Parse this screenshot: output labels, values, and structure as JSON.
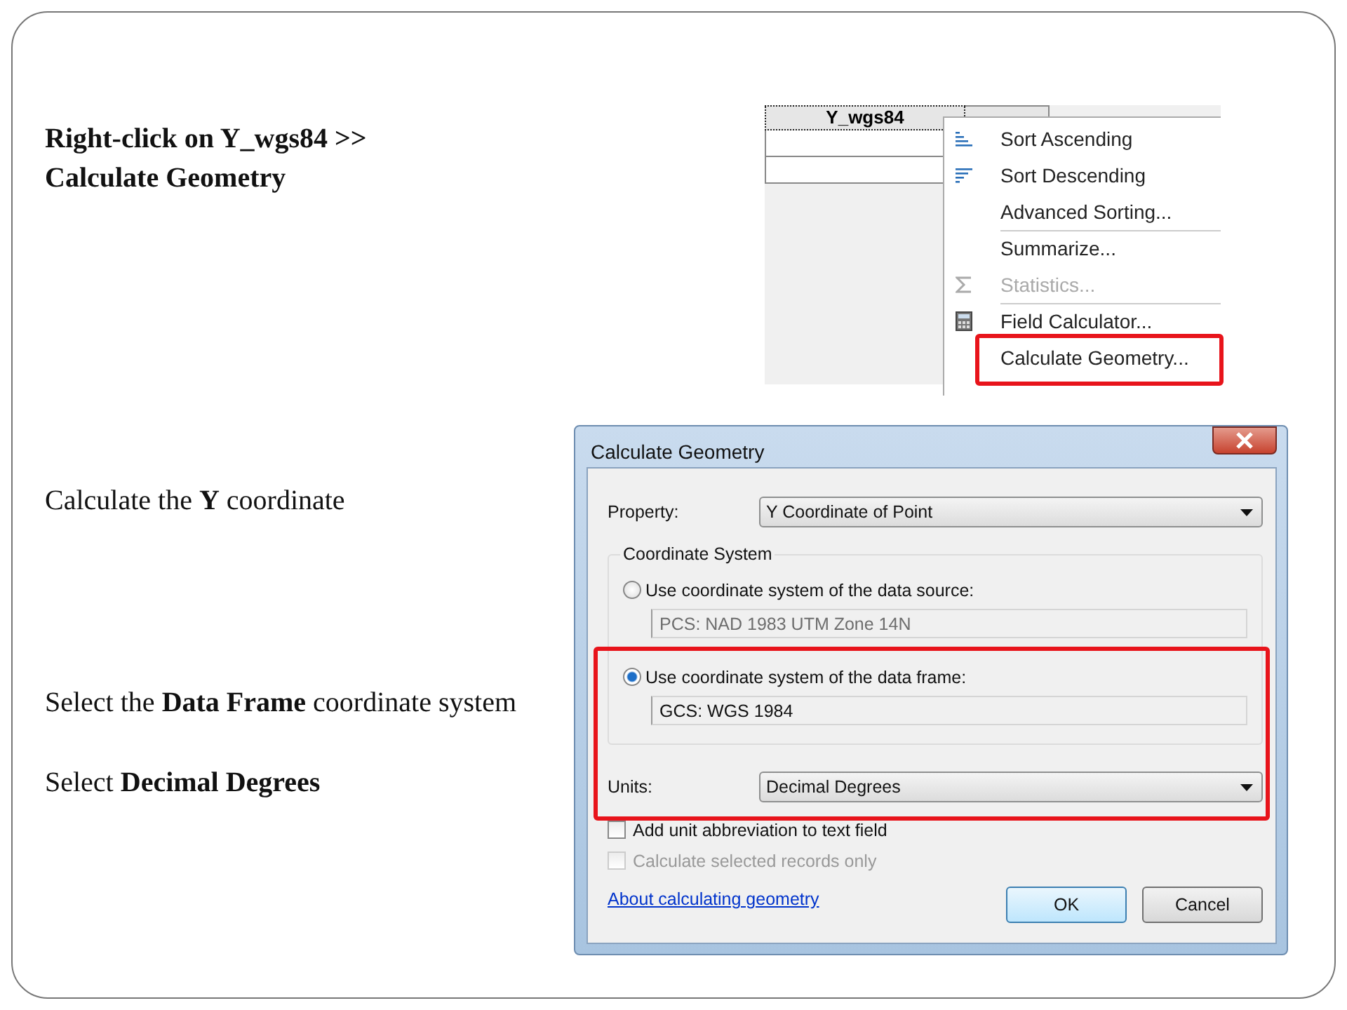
{
  "slide": {
    "heading": [
      "Right-click on Y_wgs84 >>",
      "Calculate Geometry"
    ],
    "notes": [
      "Calculate the **Y** coordinate",
      "Select the **Data Frame** coordinate system",
      "Select **Decimal Degrees**"
    ]
  },
  "table": {
    "columns": [
      "Y_wgs84",
      ""
    ]
  },
  "context_menu": {
    "items": [
      {
        "label": "Sort Ascending",
        "kind": "ascending",
        "disabled": false,
        "separator_before": false,
        "highlighted": false
      },
      {
        "label": "Sort Descending",
        "kind": "descending",
        "disabled": false,
        "separator_before": false,
        "highlighted": false
      },
      {
        "label": "Advanced Sorting...",
        "kind": "plain",
        "disabled": false,
        "separator_before": false,
        "highlighted": false
      },
      {
        "label": "Summarize...",
        "kind": "plain",
        "disabled": false,
        "separator_before": true,
        "highlighted": false
      },
      {
        "label": "Statistics...",
        "kind": "sigma",
        "disabled": true,
        "separator_before": false,
        "highlighted": false
      },
      {
        "label": "Field Calculator...",
        "kind": "calculator",
        "disabled": false,
        "separator_before": true,
        "highlighted": false
      },
      {
        "label": "Calculate Geometry...",
        "kind": "plain",
        "disabled": false,
        "separator_before": false,
        "highlighted": true
      }
    ]
  },
  "dialog": {
    "title": "Calculate Geometry",
    "property": {
      "label": "Property:",
      "value": "Y Coordinate of Point"
    },
    "group": {
      "legend": "Coordinate System",
      "options": [
        {
          "label": "Use coordinate system of the data source:",
          "selected": false,
          "value": "PCS: NAD 1983 UTM Zone 14N"
        },
        {
          "label": "Use coordinate system of the data frame:",
          "selected": true,
          "value": "GCS: WGS 1984"
        }
      ]
    },
    "units": {
      "label": "Units:",
      "value": "Decimal Degrees"
    },
    "callout": true,
    "checkboxes": [
      {
        "label": "Add unit abbreviation to text field",
        "checked": false,
        "disabled": false
      },
      {
        "label": "Calculate selected records only",
        "checked": false,
        "disabled": true
      }
    ],
    "link": "About calculating geometry",
    "buttons": [
      {
        "label": "OK",
        "default": true
      },
      {
        "label": "Cancel",
        "default": false
      }
    ]
  }
}
